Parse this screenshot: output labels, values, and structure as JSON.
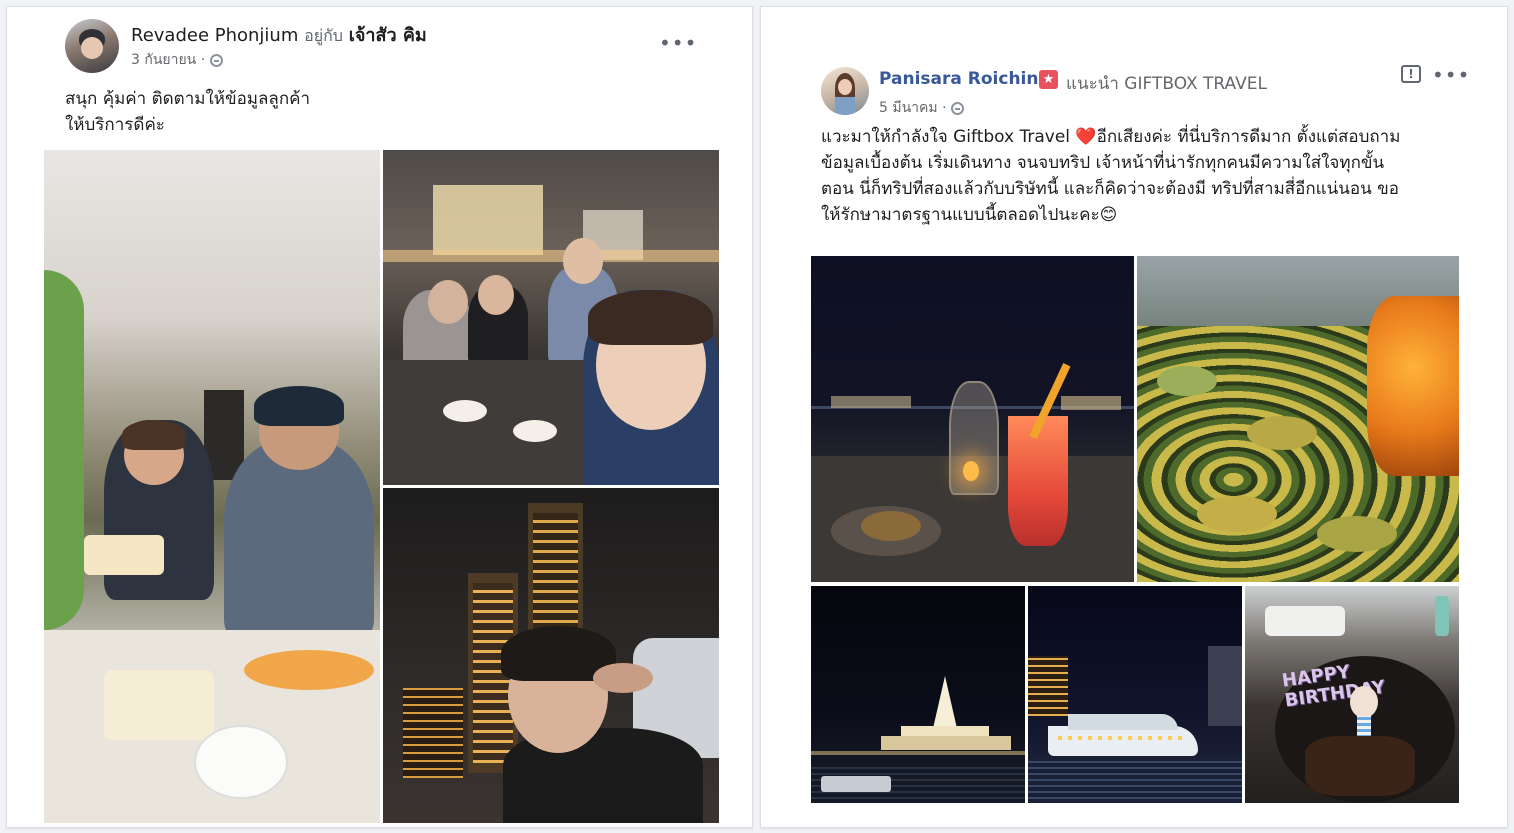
{
  "post_left": {
    "author": "Revadee Phonjium",
    "with_prefix": "อยู่กับ",
    "with_name": "เจ้าสัว คิม",
    "date": "3 กันยายน",
    "separator": "·",
    "more": "•••",
    "text_line1": "สนุก คุ้มค่า ติดตามให้ข้อมูลลูกค้า",
    "text_line2": "ให้บริการดีค่ะ",
    "photos": [
      {
        "name": "birthday-cake-restaurant-photo"
      },
      {
        "name": "group-dinner-rooftop-photo"
      },
      {
        "name": "night-skyline-selfie-photo"
      }
    ]
  },
  "post_right": {
    "author": "Panisara Roichin",
    "recommend_text": "แนะนำ GIFTBOX TRAVEL",
    "date": "5 มีนาคม",
    "separator": "·",
    "more": "•••",
    "report": "!",
    "text_lines": [
      "แวะมาให้กำลังใจ Giftbox Travel ❤️อีกเสียงค่ะ ที่นี่บริการดีมาก ตั้งแต่สอบถาม",
      "ข้อมูลเบื้องต้น เริ่มเดินทาง จนจบทริป เจ้าหน้าที่น่ารักทุกคนมีความใส่ใจทุกขั้น",
      "ตอน นี่ก็ทริปที่สองแล้วกับบริษัทนี้ และก็คิดว่าจะต้องมี ทริปที่สามสี่อีกแน่นอน ขอ",
      "ให้รักษามาตรฐานแบบนี้ตลอดไปนะคะ😊"
    ],
    "photos": [
      {
        "name": "cocktail-candle-night-photo"
      },
      {
        "name": "mussels-buffet-photo"
      },
      {
        "name": "temple-night-river-photo"
      },
      {
        "name": "river-cruise-boat-photo"
      },
      {
        "name": "happy-birthday-cake-photo"
      }
    ],
    "cake_text": "HAPPY BIRTHDAY"
  },
  "colors": {
    "author_left": "#1c1e21",
    "author_right": "#385898",
    "recommend_badge": "#e9515f",
    "heart": "#e0245e"
  }
}
